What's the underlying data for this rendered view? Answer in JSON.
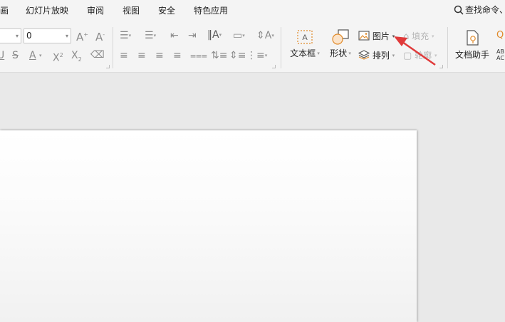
{
  "menu": {
    "items": [
      {
        "id": "animation-tail",
        "label": "画"
      },
      {
        "id": "slideshow",
        "label": "幻灯片放映"
      },
      {
        "id": "review",
        "label": "审阅"
      },
      {
        "id": "view",
        "label": "视图"
      },
      {
        "id": "security",
        "label": "安全"
      },
      {
        "id": "special",
        "label": "特色应用"
      }
    ],
    "search_label": "查找命令、"
  },
  "ribbon": {
    "font_size_value": "0",
    "textbox_label": "文本框",
    "shape_label": "形状",
    "picture_label": "图片",
    "arrange_label": "排列",
    "fill_label": "填充",
    "outline_label": "轮廓",
    "doc_assistant_label": "文档助手"
  },
  "icons": {
    "search": "search-icon",
    "picture": "picture-icon",
    "arrange": "layers-icon",
    "textbox": "textbox-icon",
    "shape": "shape-icon",
    "doc_assistant": "document-icon"
  },
  "colors": {
    "accent": "#e03a3a",
    "icon_orange": "#e08a2a",
    "ribbon_bg": "#f4f4f4",
    "workspace_bg": "#e9e9e9"
  }
}
